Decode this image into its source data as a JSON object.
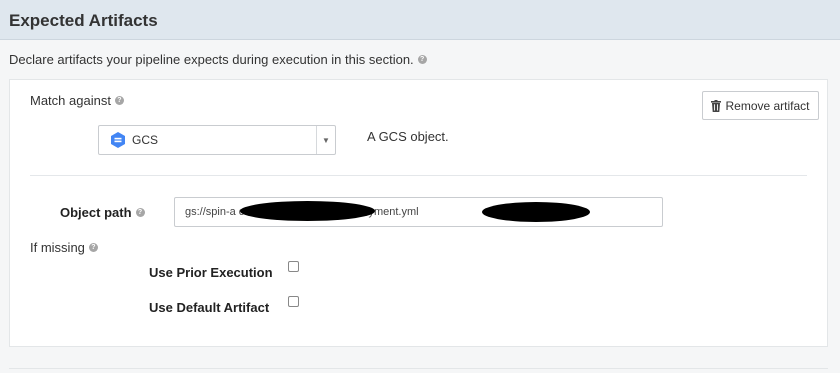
{
  "header": {
    "title": "Expected Artifacts"
  },
  "description": "Declare artifacts your pipeline expects during execution in this section.",
  "help_icon_text": "?",
  "card": {
    "match_label": "Match against",
    "type_select": {
      "value": "GCS",
      "icon": "gcs-icon"
    },
    "type_help": "A GCS object.",
    "remove_button": {
      "label": "Remove artifact",
      "icon": "trash-icon"
    },
    "object_path_label": "Object path",
    "object_path_value": "gs://spin-a                          cd65cac2608a/front50/                            ployment.yml",
    "if_missing_label": "If missing",
    "use_prior_label": "Use Prior Execution",
    "use_prior_checked": false,
    "use_default_label": "Use Default Artifact",
    "use_default_checked": false
  },
  "colors": {
    "header_bg": "#dfe7ee",
    "gcs_blue": "#4285f4",
    "page_bg": "#f5f6f7"
  }
}
